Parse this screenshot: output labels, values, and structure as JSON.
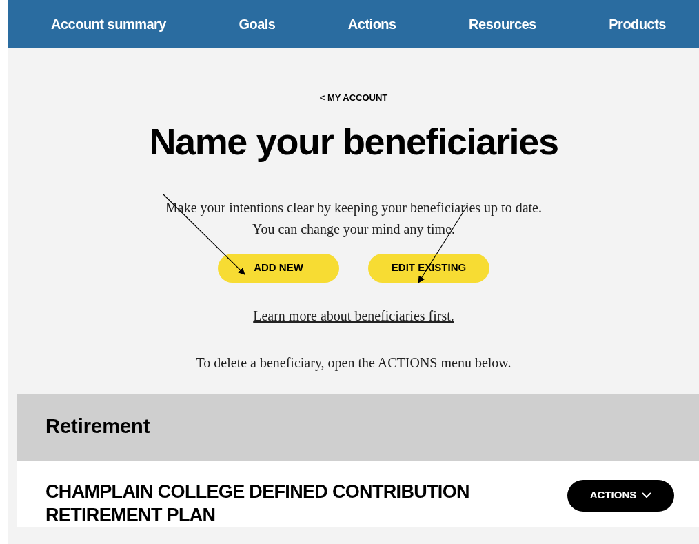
{
  "nav": {
    "items": [
      {
        "label": "Account summary"
      },
      {
        "label": "Goals"
      },
      {
        "label": "Actions"
      },
      {
        "label": "Resources"
      },
      {
        "label": "Products"
      }
    ]
  },
  "breadcrumb": "< MY ACCOUNT",
  "title": "Name your beneficiaries",
  "intro": [
    "Make your intentions clear by keeping your beneficiaries up to date.",
    "You can change your mind any time."
  ],
  "buttons": [
    "ADD NEW",
    "EDIT EXISTING"
  ],
  "learn_link": "Learn more about beneficiaries first.",
  "delete_note": "To delete a beneficiary, open the ACTIONS menu below.",
  "section": {
    "title": "Retirement"
  },
  "plan": {
    "name": "CHAMPLAIN COLLEGE DEFINED CONTRIBUTION RETIREMENT PLAN",
    "actions_button": "ACTIONS"
  },
  "annotations": [
    {
      "kind": "arrow"
    },
    {
      "kind": "arrow"
    }
  ]
}
